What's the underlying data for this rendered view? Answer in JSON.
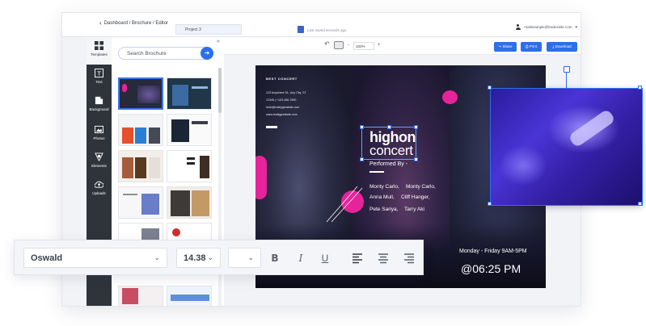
{
  "topbar": {
    "breadcrumb": "Dashboard / Brochure / Editor",
    "project": "Project 3",
    "saved_status": "Last saved seconds ago",
    "user_email": "mailexample@tradexsite.com"
  },
  "rail": {
    "items": [
      {
        "label": "Templates",
        "icon": "templates-icon"
      },
      {
        "label": "Text",
        "icon": "text-icon"
      },
      {
        "label": "Background",
        "icon": "background-icon"
      },
      {
        "label": "Photos",
        "icon": "photos-icon"
      },
      {
        "label": "Elements",
        "icon": "elements-icon"
      },
      {
        "label": "Uploads",
        "icon": "uploads-icon"
      }
    ]
  },
  "panel": {
    "search_placeholder": "Search Brochure"
  },
  "toolrow": {
    "zoom": "100%",
    "share": "Share",
    "print": "Print",
    "download": "Download"
  },
  "brochure": {
    "heading": "BEST CONCERT",
    "address": "123 Anywhere St., Any City, ST",
    "phone": "12345 | +123-456-7890",
    "email": "hello@reallygreatsite.com",
    "website": "www.reallygreatsite.com",
    "title_line1": "highon",
    "title_line2": "concert",
    "performed_by": "Performed By -",
    "performers": [
      "Monty Carlo,",
      "Monty Carlo,",
      "Anna Mull,",
      "Cliff Hanger,",
      "Pete Sariya,",
      "Tarry Aki"
    ],
    "days": "Monday - Friday 9AM-5PM",
    "time": "@06:25 PM"
  },
  "fontbar": {
    "font_family": "Oswald",
    "font_size": "14.38",
    "spacing": ""
  },
  "colors": {
    "accent": "#2b6ff0",
    "pink": "#e6239a",
    "rail": "#2f343b"
  }
}
